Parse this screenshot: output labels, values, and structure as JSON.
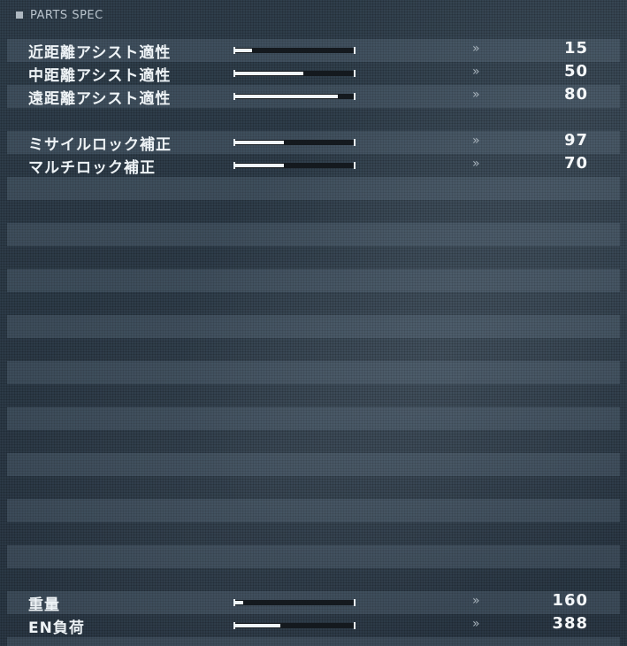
{
  "header": {
    "title": "PARTS SPEC"
  },
  "assist": [
    {
      "label": "近距離アシスト適性",
      "value": "15",
      "level": 0.15
    },
    {
      "label": "中距離アシスト適性",
      "value": "50",
      "level": 0.57
    },
    {
      "label": "遠距離アシスト適性",
      "value": "80",
      "level": 0.86
    }
  ],
  "lock": [
    {
      "label": "ミサイルロック補正",
      "value": "97",
      "level": 0.41
    },
    {
      "label": "マルチロック補正",
      "value": "70",
      "level": 0.41
    }
  ],
  "footer": [
    {
      "label": "重量",
      "value": "160",
      "level": 0.07
    },
    {
      "label": "EN負荷",
      "value": "388",
      "level": 0.38
    }
  ],
  "arrow_glyph": "»"
}
